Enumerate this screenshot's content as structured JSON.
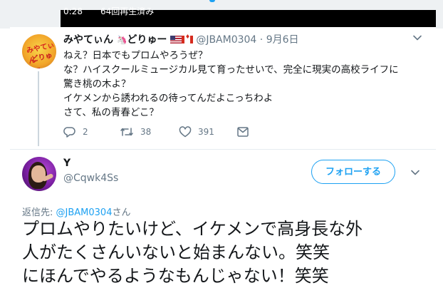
{
  "video": {
    "time": "0:28",
    "views": "64回再生済み"
  },
  "tweet_parent": {
    "display_name": "みやてぃん",
    "display_name_suffix": "どりゅー",
    "handle": "@JBAM0304",
    "separator": "·",
    "date": "9月6日",
    "lines": [
      "ねえ？日本でもプロムやろうぜ？",
      "な？ハイスクールミュージカル見て育ったせいで、完全に現実の高校ライフに",
      "驚き桃の木よ？",
      "イケメンから誘われるの待ってんだよこっちわよ",
      "さて、私の青春どこ？"
    ],
    "actions": {
      "replies": "2",
      "retweets": "38",
      "likes": "391"
    },
    "avatar_text": [
      "みやてぃん",
      "どりゅー"
    ]
  },
  "tweet_main": {
    "display_name": "Y",
    "handle": "@Cqwk4Ss",
    "follow_label": "フォローする",
    "reply_prefix": "返信先:",
    "reply_mention": "@JBAM0304",
    "reply_suffix": "さん",
    "lines": [
      "プロムやりたいけど、イケメンで高身長な外",
      "人がたくさんいないと始まんない。笑笑",
      "にほんでやるようなもんじゃない！笑笑"
    ]
  },
  "icons": {
    "reply": "reply-icon",
    "retweet": "retweet-icon",
    "like": "heart-icon",
    "dm": "envelope-icon",
    "caret": "chevron-down-icon"
  },
  "colors": {
    "accent": "#1da1f2",
    "secondary_text": "#657786",
    "primary_text": "#14171a"
  }
}
